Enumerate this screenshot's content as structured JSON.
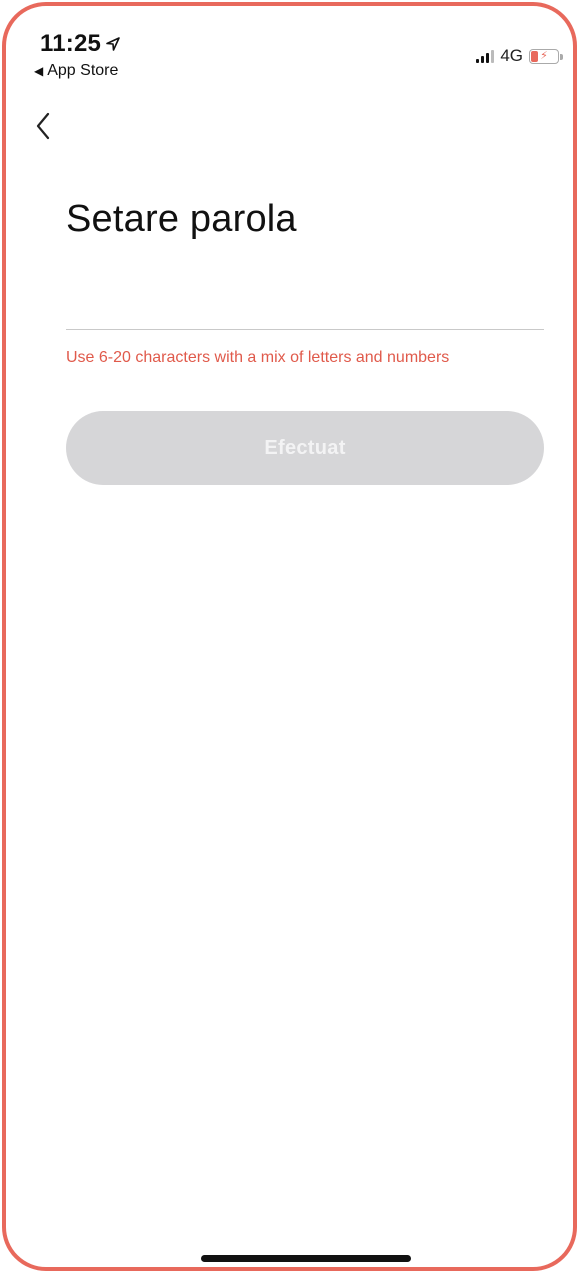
{
  "status_bar": {
    "time": "11:25",
    "back_app_label": "App Store",
    "network": "4G"
  },
  "page": {
    "title": "Setare parola",
    "password_value": "",
    "password_placeholder": "",
    "hint": "Use 6-20 characters with a mix of letters and numbers",
    "done_label": "Efectuat"
  },
  "icons": {
    "back": "chevron-left-icon",
    "location": "location-arrow-icon",
    "signal": "cellular-signal-icon",
    "battery": "battery-charging-icon"
  },
  "colors": {
    "frame_border": "#e8695c",
    "hint_text": "#e05a4b",
    "button_disabled_bg": "#d6d6d8",
    "button_disabled_text": "#f3f3f4"
  }
}
